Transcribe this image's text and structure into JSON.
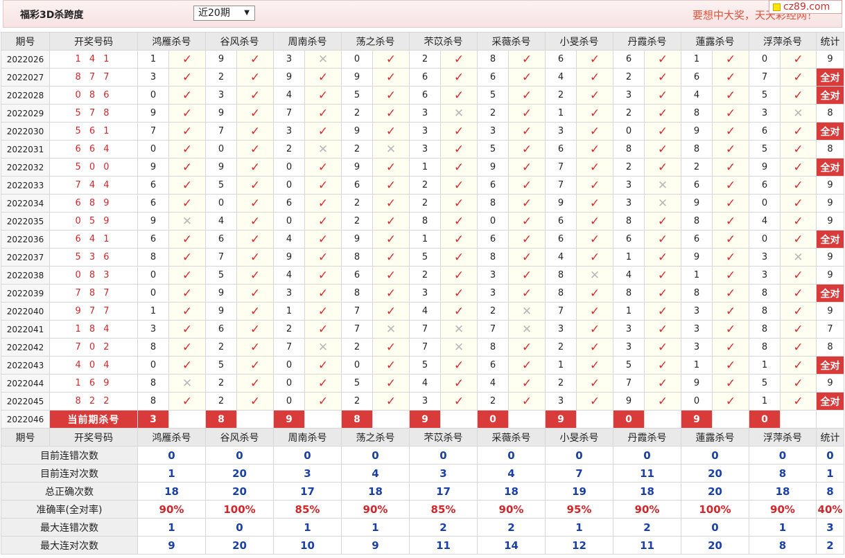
{
  "header": {
    "title": "福彩3D杀跨度",
    "period_select": "近20期",
    "slogan": "要想中大奖，天天彩经网！",
    "logo": "cz89.com"
  },
  "columns": {
    "issue": "期号",
    "draw": "开奖号码",
    "experts": [
      "鸿雁杀号",
      "谷风杀号",
      "周南杀号",
      "荡之杀号",
      "芣苡杀号",
      "采薇杀号",
      "小旻杀号",
      "丹霞杀号",
      "蓮露杀号",
      "浮萍杀号"
    ],
    "stat": "统计"
  },
  "rows": [
    {
      "issue": "2022026",
      "draw": "1 4 1",
      "picks": [
        [
          "1",
          "ok"
        ],
        [
          "9",
          "ok"
        ],
        [
          "3",
          "no"
        ],
        [
          "0",
          "ok"
        ],
        [
          "2",
          "ok"
        ],
        [
          "8",
          "ok"
        ],
        [
          "6",
          "ok"
        ],
        [
          "6",
          "ok"
        ],
        [
          "1",
          "ok"
        ],
        [
          "0",
          "ok"
        ]
      ],
      "stat": "9"
    },
    {
      "issue": "2022027",
      "draw": "8 7 7",
      "picks": [
        [
          "3",
          "ok"
        ],
        [
          "2",
          "ok"
        ],
        [
          "9",
          "ok"
        ],
        [
          "9",
          "ok"
        ],
        [
          "6",
          "ok"
        ],
        [
          "6",
          "ok"
        ],
        [
          "4",
          "ok"
        ],
        [
          "2",
          "ok"
        ],
        [
          "6",
          "ok"
        ],
        [
          "7",
          "ok"
        ]
      ],
      "stat": "全对"
    },
    {
      "issue": "2022028",
      "draw": "0 8 6",
      "picks": [
        [
          "0",
          "ok"
        ],
        [
          "3",
          "ok"
        ],
        [
          "4",
          "ok"
        ],
        [
          "5",
          "ok"
        ],
        [
          "6",
          "ok"
        ],
        [
          "5",
          "ok"
        ],
        [
          "2",
          "ok"
        ],
        [
          "3",
          "ok"
        ],
        [
          "4",
          "ok"
        ],
        [
          "5",
          "ok"
        ]
      ],
      "stat": "全对"
    },
    {
      "issue": "2022029",
      "draw": "5 7 8",
      "picks": [
        [
          "9",
          "ok"
        ],
        [
          "9",
          "ok"
        ],
        [
          "7",
          "ok"
        ],
        [
          "2",
          "ok"
        ],
        [
          "3",
          "no"
        ],
        [
          "2",
          "ok"
        ],
        [
          "1",
          "ok"
        ],
        [
          "2",
          "ok"
        ],
        [
          "8",
          "ok"
        ],
        [
          "3",
          "no"
        ]
      ],
      "stat": "8"
    },
    {
      "issue": "2022030",
      "draw": "5 6 1",
      "picks": [
        [
          "7",
          "ok"
        ],
        [
          "7",
          "ok"
        ],
        [
          "3",
          "ok"
        ],
        [
          "9",
          "ok"
        ],
        [
          "3",
          "ok"
        ],
        [
          "3",
          "ok"
        ],
        [
          "3",
          "ok"
        ],
        [
          "0",
          "ok"
        ],
        [
          "9",
          "ok"
        ],
        [
          "6",
          "ok"
        ]
      ],
      "stat": "全对"
    },
    {
      "issue": "2022031",
      "draw": "6 6 4",
      "picks": [
        [
          "0",
          "ok"
        ],
        [
          "0",
          "ok"
        ],
        [
          "2",
          "no"
        ],
        [
          "2",
          "no"
        ],
        [
          "3",
          "ok"
        ],
        [
          "5",
          "ok"
        ],
        [
          "6",
          "ok"
        ],
        [
          "8",
          "ok"
        ],
        [
          "8",
          "ok"
        ],
        [
          "5",
          "ok"
        ]
      ],
      "stat": "8"
    },
    {
      "issue": "2022032",
      "draw": "5 0 0",
      "picks": [
        [
          "9",
          "ok"
        ],
        [
          "9",
          "ok"
        ],
        [
          "0",
          "ok"
        ],
        [
          "9",
          "ok"
        ],
        [
          "1",
          "ok"
        ],
        [
          "9",
          "ok"
        ],
        [
          "7",
          "ok"
        ],
        [
          "2",
          "ok"
        ],
        [
          "2",
          "ok"
        ],
        [
          "9",
          "ok"
        ]
      ],
      "stat": "全对"
    },
    {
      "issue": "2022033",
      "draw": "7 4 4",
      "picks": [
        [
          "6",
          "ok"
        ],
        [
          "5",
          "ok"
        ],
        [
          "0",
          "ok"
        ],
        [
          "6",
          "ok"
        ],
        [
          "2",
          "ok"
        ],
        [
          "6",
          "ok"
        ],
        [
          "7",
          "ok"
        ],
        [
          "3",
          "no"
        ],
        [
          "6",
          "ok"
        ],
        [
          "6",
          "ok"
        ]
      ],
      "stat": "9"
    },
    {
      "issue": "2022034",
      "draw": "6 8 9",
      "picks": [
        [
          "6",
          "ok"
        ],
        [
          "0",
          "ok"
        ],
        [
          "6",
          "ok"
        ],
        [
          "2",
          "ok"
        ],
        [
          "2",
          "ok"
        ],
        [
          "8",
          "ok"
        ],
        [
          "9",
          "ok"
        ],
        [
          "3",
          "no"
        ],
        [
          "9",
          "ok"
        ],
        [
          "0",
          "ok"
        ]
      ],
      "stat": "9"
    },
    {
      "issue": "2022035",
      "draw": "0 5 9",
      "picks": [
        [
          "9",
          "no"
        ],
        [
          "4",
          "ok"
        ],
        [
          "0",
          "ok"
        ],
        [
          "2",
          "ok"
        ],
        [
          "8",
          "ok"
        ],
        [
          "0",
          "ok"
        ],
        [
          "6",
          "ok"
        ],
        [
          "8",
          "ok"
        ],
        [
          "8",
          "ok"
        ],
        [
          "4",
          "ok"
        ]
      ],
      "stat": "9"
    },
    {
      "issue": "2022036",
      "draw": "6 4 1",
      "picks": [
        [
          "6",
          "ok"
        ],
        [
          "6",
          "ok"
        ],
        [
          "4",
          "ok"
        ],
        [
          "9",
          "ok"
        ],
        [
          "1",
          "ok"
        ],
        [
          "6",
          "ok"
        ],
        [
          "6",
          "ok"
        ],
        [
          "6",
          "ok"
        ],
        [
          "6",
          "ok"
        ],
        [
          "0",
          "ok"
        ]
      ],
      "stat": "全对"
    },
    {
      "issue": "2022037",
      "draw": "5 3 6",
      "picks": [
        [
          "8",
          "ok"
        ],
        [
          "7",
          "ok"
        ],
        [
          "9",
          "ok"
        ],
        [
          "8",
          "ok"
        ],
        [
          "5",
          "ok"
        ],
        [
          "8",
          "ok"
        ],
        [
          "4",
          "ok"
        ],
        [
          "1",
          "ok"
        ],
        [
          "9",
          "ok"
        ],
        [
          "3",
          "no"
        ]
      ],
      "stat": "9"
    },
    {
      "issue": "2022038",
      "draw": "0 8 3",
      "picks": [
        [
          "0",
          "ok"
        ],
        [
          "5",
          "ok"
        ],
        [
          "4",
          "ok"
        ],
        [
          "6",
          "ok"
        ],
        [
          "2",
          "ok"
        ],
        [
          "3",
          "ok"
        ],
        [
          "8",
          "no"
        ],
        [
          "4",
          "ok"
        ],
        [
          "1",
          "ok"
        ],
        [
          "3",
          "ok"
        ]
      ],
      "stat": "9"
    },
    {
      "issue": "2022039",
      "draw": "7 8 7",
      "picks": [
        [
          "0",
          "ok"
        ],
        [
          "9",
          "ok"
        ],
        [
          "3",
          "ok"
        ],
        [
          "8",
          "ok"
        ],
        [
          "3",
          "ok"
        ],
        [
          "3",
          "ok"
        ],
        [
          "8",
          "ok"
        ],
        [
          "8",
          "ok"
        ],
        [
          "8",
          "ok"
        ],
        [
          "8",
          "ok"
        ]
      ],
      "stat": "全对"
    },
    {
      "issue": "2022040",
      "draw": "9 7 7",
      "picks": [
        [
          "1",
          "ok"
        ],
        [
          "9",
          "ok"
        ],
        [
          "1",
          "ok"
        ],
        [
          "7",
          "ok"
        ],
        [
          "4",
          "ok"
        ],
        [
          "2",
          "no"
        ],
        [
          "7",
          "ok"
        ],
        [
          "1",
          "ok"
        ],
        [
          "3",
          "ok"
        ],
        [
          "8",
          "ok"
        ]
      ],
      "stat": "9"
    },
    {
      "issue": "2022041",
      "draw": "1 8 4",
      "picks": [
        [
          "3",
          "ok"
        ],
        [
          "6",
          "ok"
        ],
        [
          "2",
          "ok"
        ],
        [
          "7",
          "no"
        ],
        [
          "7",
          "no"
        ],
        [
          "7",
          "no"
        ],
        [
          "3",
          "ok"
        ],
        [
          "3",
          "ok"
        ],
        [
          "3",
          "ok"
        ],
        [
          "8",
          "ok"
        ]
      ],
      "stat": "7"
    },
    {
      "issue": "2022042",
      "draw": "7 0 2",
      "picks": [
        [
          "8",
          "ok"
        ],
        [
          "2",
          "ok"
        ],
        [
          "7",
          "no"
        ],
        [
          "2",
          "ok"
        ],
        [
          "7",
          "no"
        ],
        [
          "8",
          "ok"
        ],
        [
          "2",
          "ok"
        ],
        [
          "3",
          "ok"
        ],
        [
          "3",
          "ok"
        ],
        [
          "8",
          "ok"
        ]
      ],
      "stat": "8"
    },
    {
      "issue": "2022043",
      "draw": "4 0 4",
      "picks": [
        [
          "0",
          "ok"
        ],
        [
          "5",
          "ok"
        ],
        [
          "0",
          "ok"
        ],
        [
          "0",
          "ok"
        ],
        [
          "5",
          "ok"
        ],
        [
          "6",
          "ok"
        ],
        [
          "1",
          "ok"
        ],
        [
          "5",
          "ok"
        ],
        [
          "1",
          "ok"
        ],
        [
          "1",
          "ok"
        ]
      ],
      "stat": "全对"
    },
    {
      "issue": "2022044",
      "draw": "1 6 9",
      "picks": [
        [
          "8",
          "no"
        ],
        [
          "2",
          "ok"
        ],
        [
          "0",
          "ok"
        ],
        [
          "5",
          "ok"
        ],
        [
          "4",
          "ok"
        ],
        [
          "4",
          "ok"
        ],
        [
          "2",
          "ok"
        ],
        [
          "7",
          "ok"
        ],
        [
          "9",
          "ok"
        ],
        [
          "5",
          "ok"
        ]
      ],
      "stat": "9"
    },
    {
      "issue": "2022045",
      "draw": "8 2 2",
      "picks": [
        [
          "8",
          "ok"
        ],
        [
          "2",
          "ok"
        ],
        [
          "0",
          "ok"
        ],
        [
          "2",
          "ok"
        ],
        [
          "3",
          "ok"
        ],
        [
          "2",
          "ok"
        ],
        [
          "3",
          "ok"
        ],
        [
          "9",
          "ok"
        ],
        [
          "0",
          "ok"
        ],
        [
          "1",
          "ok"
        ]
      ],
      "stat": "全对"
    }
  ],
  "current": {
    "issue": "2022046",
    "label": "当前期杀号",
    "picks": [
      "3",
      "8",
      "9",
      "8",
      "9",
      "0",
      "9",
      "0",
      "9",
      "0"
    ]
  },
  "summary": [
    {
      "label": "目前连错次数",
      "values": [
        "0",
        "0",
        "0",
        "0",
        "0",
        "0",
        "0",
        "0",
        "0",
        "0"
      ],
      "stat": "0",
      "style": "blue"
    },
    {
      "label": "目前连对次数",
      "values": [
        "1",
        "20",
        "3",
        "4",
        "3",
        "4",
        "7",
        "11",
        "20",
        "8"
      ],
      "stat": "1",
      "style": "blue"
    },
    {
      "label": "总正确次数",
      "values": [
        "18",
        "20",
        "17",
        "18",
        "17",
        "18",
        "19",
        "18",
        "20",
        "18"
      ],
      "stat": "8",
      "style": "blue"
    },
    {
      "label": "准确率(全对率)",
      "values": [
        "90%",
        "100%",
        "85%",
        "90%",
        "85%",
        "90%",
        "95%",
        "90%",
        "100%",
        "90%"
      ],
      "stat": "40%",
      "style": "red"
    },
    {
      "label": "最大连错次数",
      "values": [
        "1",
        "0",
        "1",
        "1",
        "2",
        "2",
        "1",
        "2",
        "0",
        "1"
      ],
      "stat": "3",
      "style": "blue"
    },
    {
      "label": "最大连对次数",
      "values": [
        "9",
        "20",
        "10",
        "9",
        "11",
        "14",
        "12",
        "11",
        "20",
        "8"
      ],
      "stat": "2",
      "style": "blue"
    }
  ],
  "marks": {
    "ok": "✓",
    "no": "✕"
  },
  "colors": {
    "accent_red": "#d93a3a",
    "summary_blue": "#1a3fa8",
    "check_red": "#d42d2d"
  }
}
